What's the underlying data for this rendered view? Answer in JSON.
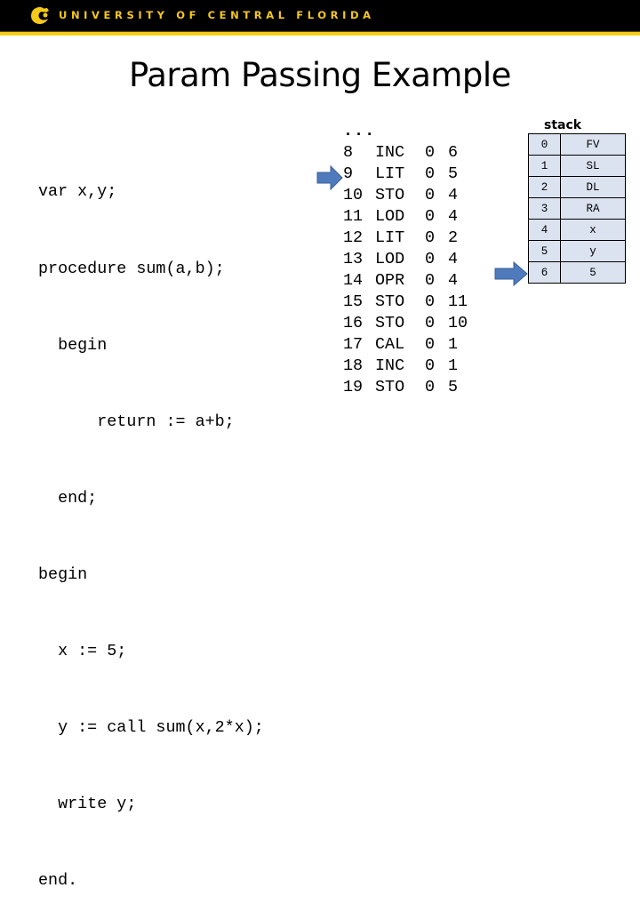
{
  "header": {
    "university_name": "UNIVERSITY OF CENTRAL FLORIDA",
    "logo_icon": "pegasus-logo-icon",
    "colors": {
      "bar": "#000000",
      "gold": "#f5c81a"
    }
  },
  "slide": {
    "title": "Param Passing Example"
  },
  "source_code": {
    "lines": [
      "var x,y;",
      "procedure sum(a,b);",
      "  begin",
      "      return := a+b;",
      "  end;",
      "begin",
      "  x := 5;",
      "  y := call sum(x,2*x);",
      "  write y;",
      "end."
    ]
  },
  "instructions": {
    "ellipsis": "...",
    "rows": [
      {
        "line": "8",
        "op": "INC",
        "l": "0",
        "m": "6"
      },
      {
        "line": "9",
        "op": "LIT",
        "l": "0",
        "m": "5"
      },
      {
        "line": "10",
        "op": "STO",
        "l": "0",
        "m": "4"
      },
      {
        "line": "11",
        "op": "LOD",
        "l": "0",
        "m": "4"
      },
      {
        "line": "12",
        "op": "LIT",
        "l": "0",
        "m": "2"
      },
      {
        "line": "13",
        "op": "LOD",
        "l": "0",
        "m": "4"
      },
      {
        "line": "14",
        "op": "OPR",
        "l": "0",
        "m": "4"
      },
      {
        "line": "15",
        "op": "STO",
        "l": "0",
        "m": "11"
      },
      {
        "line": "16",
        "op": "STO",
        "l": "0",
        "m": "10"
      },
      {
        "line": "17",
        "op": "CAL",
        "l": "0",
        "m": "1"
      },
      {
        "line": "18",
        "op": "INC",
        "l": "0",
        "m": "1"
      },
      {
        "line": "19",
        "op": "STO",
        "l": "0",
        "m": "5"
      }
    ],
    "pc_arrow_at_line": "9"
  },
  "stack": {
    "label": "stack",
    "rows": [
      {
        "index": "0",
        "value": "FV"
      },
      {
        "index": "1",
        "value": "SL"
      },
      {
        "index": "2",
        "value": "DL"
      },
      {
        "index": "3",
        "value": "RA"
      },
      {
        "index": "4",
        "value": "x"
      },
      {
        "index": "5",
        "value": "y"
      },
      {
        "index": "6",
        "value": "5"
      }
    ],
    "sp_arrow_at_index": "6",
    "cell_color": "#dbe3f0"
  },
  "arrow_color": "#4f7bbd"
}
